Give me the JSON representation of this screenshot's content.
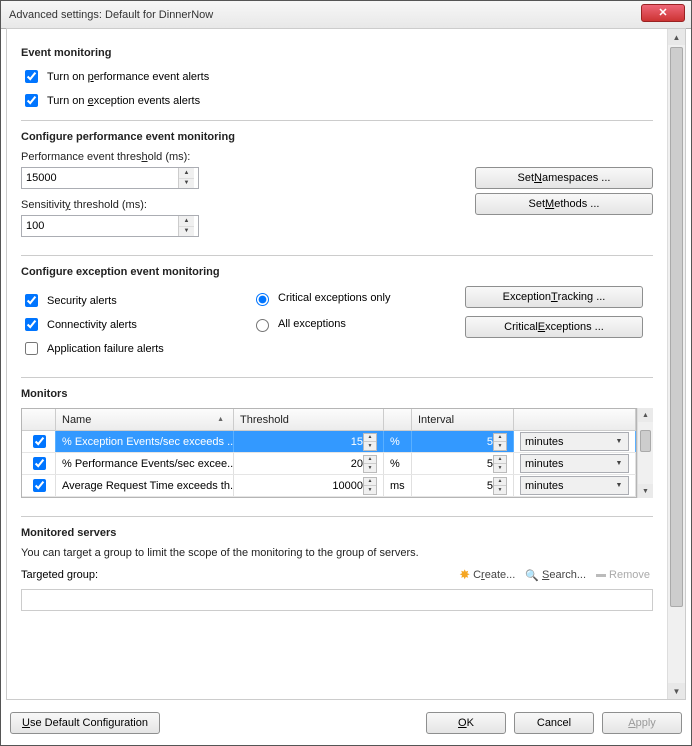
{
  "window": {
    "title": "Advanced settings: Default for DinnerNow"
  },
  "sections": {
    "event_monitoring": {
      "heading": "Event monitoring",
      "perf_alerts": "Turn on performance event alerts",
      "exc_alerts": "Turn on exception events alerts"
    },
    "perf": {
      "heading": "Configure performance event monitoring",
      "threshold_label": "Performance event threshold (ms):",
      "threshold_value": "15000",
      "sensitivity_label": "Sensitivity threshold (ms):",
      "sensitivity_value": "100",
      "set_ns": "Set Namespaces ...",
      "set_methods": "Set Methods ..."
    },
    "exc": {
      "heading": "Configure exception event monitoring",
      "security": "Security alerts",
      "connectivity": "Connectivity alerts",
      "app_failure": "Application failure alerts",
      "crit_only": "Critical exceptions only",
      "all_exc": "All exceptions",
      "exc_tracking": "Exception Tracking ...",
      "crit_exc": "Critical Exceptions ..."
    },
    "monitors": {
      "heading": "Monitors",
      "col_name": "Name",
      "col_threshold": "Threshold",
      "col_interval": "Interval",
      "rows": [
        {
          "checked": true,
          "name": "% Exception Events/sec exceeds ...",
          "threshold": "15",
          "unit": "%",
          "interval": "5",
          "interval_unit": "minutes"
        },
        {
          "checked": true,
          "name": "% Performance Events/sec excee...",
          "threshold": "20",
          "unit": "%",
          "interval": "5",
          "interval_unit": "minutes"
        },
        {
          "checked": true,
          "name": "Average Request Time exceeds th...",
          "threshold": "10000",
          "unit": "ms",
          "interval": "5",
          "interval_unit": "minutes"
        }
      ]
    },
    "servers": {
      "heading": "Monitored servers",
      "desc": "You can target a group to limit the scope of the monitoring to the group of servers.",
      "target_label": "Targeted group:",
      "create": "Create...",
      "search": "Search...",
      "remove": "Remove"
    }
  },
  "buttons": {
    "use_default": "Use Default Configuration",
    "ok": "OK",
    "cancel": "Cancel",
    "apply": "Apply"
  }
}
